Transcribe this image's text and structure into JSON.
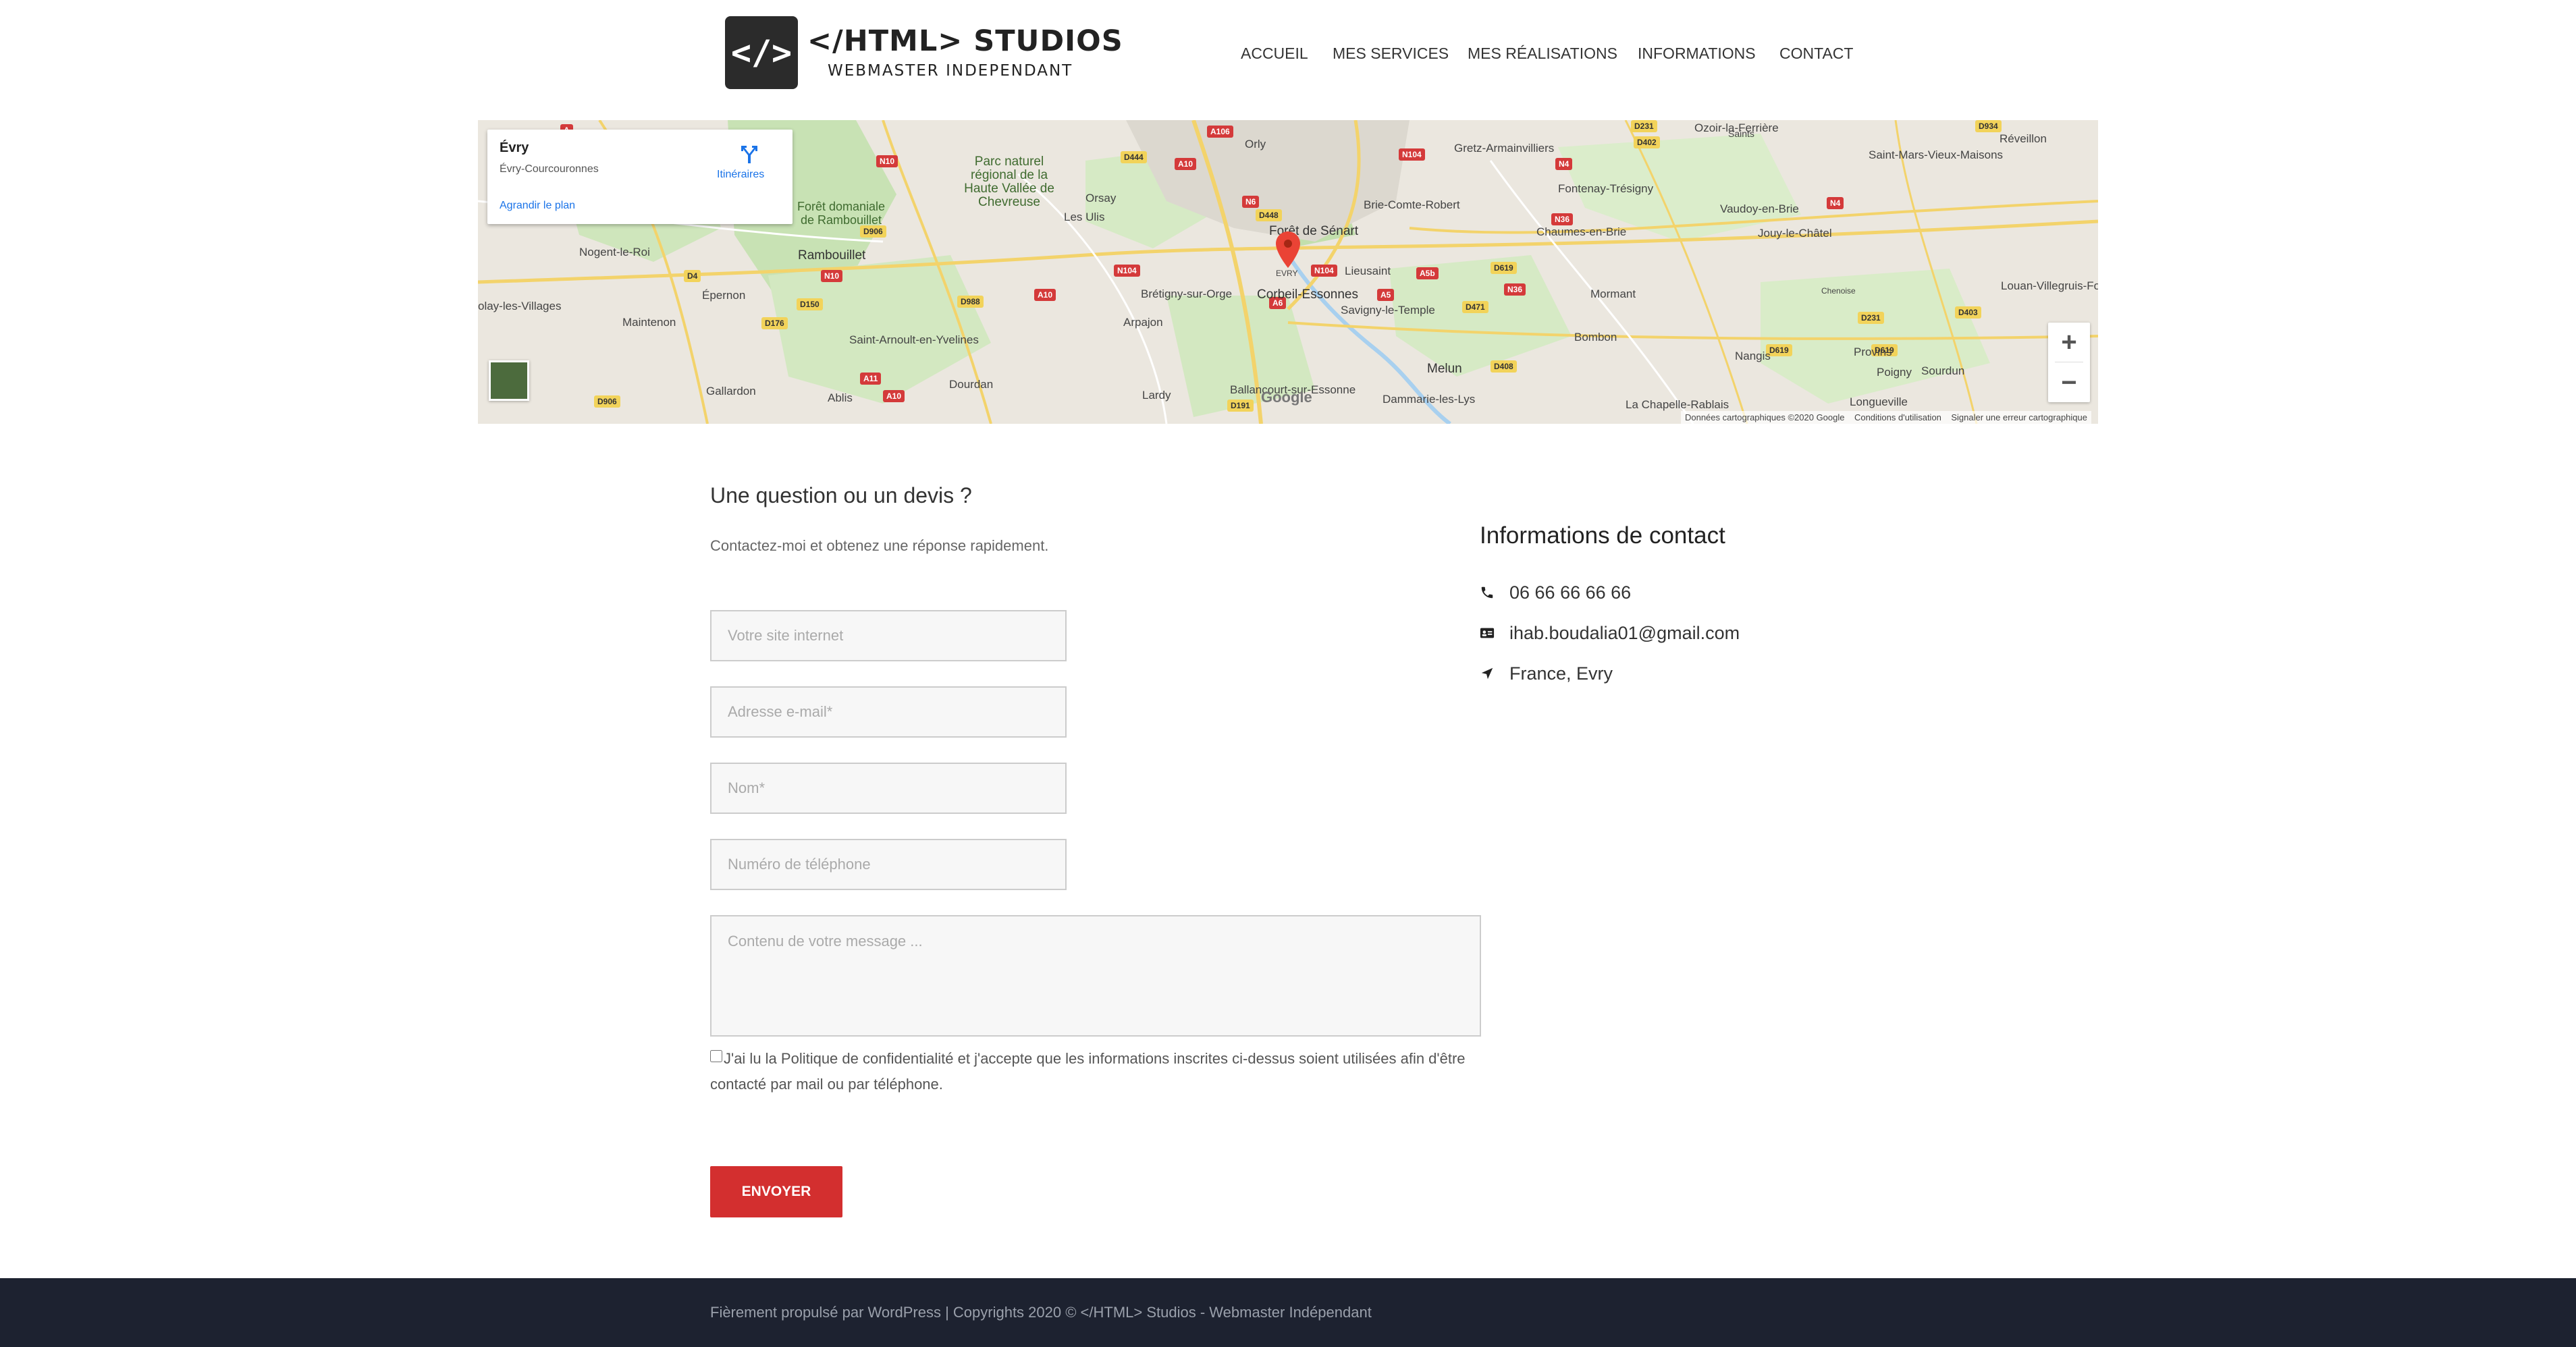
{
  "header": {
    "logo_glyph": "</>",
    "brand_title": "</HTML> STUDIOS",
    "brand_subtitle": "WEBMASTER INDEPENDANT",
    "nav": [
      {
        "label": "ACCUEIL"
      },
      {
        "label": "MES SERVICES"
      },
      {
        "label": "MES RÉALISATIONS"
      },
      {
        "label": "INFORMATIONS"
      },
      {
        "label": "CONTACT"
      }
    ]
  },
  "map": {
    "card_title": "Évry",
    "card_subtitle": "Évry-Courcouronnes",
    "card_link": "Agrandir le plan",
    "directions_label": "Itinéraires",
    "zoom_in": "+",
    "zoom_out": "−",
    "google": "Google",
    "footer_data": "Données cartographiques ©2020 Google",
    "footer_terms": "Conditions d'utilisation",
    "footer_report": "Signaler une erreur cartographique",
    "places": [
      "Orsay",
      "Les Ulis",
      "Arpajon",
      "Dourdan",
      "Rambouillet",
      "Épernon",
      "Maintenon",
      "Nogent-le-Roi",
      "Saint-Arnoult-en-Yvelines",
      "Gallardon",
      "Ablis",
      "Lardy",
      "Brétigny-sur-Orge",
      "Forêt de Sénart",
      "Corbeil-Essonnes",
      "Savigny-le-Temple",
      "Lieusaint",
      "Melun",
      "Dammarie-les-Lys",
      "Brie-Comte-Robert",
      "Gretz-Armainvilliers",
      "Fontenay-Trésigny",
      "Chaumes-en-Brie",
      "Vaudoy-en-Brie",
      "Jouy-le-Châtel",
      "Mormant",
      "Bombon",
      "Nangis",
      "Provins",
      "Sourdun",
      "Poigny",
      "Longueville",
      "La Chapelle-Rablais",
      "Saints",
      "Saint-Mars-Vieux-Maisons",
      "Réveillon",
      "Louan-Villegruis-Fon",
      "Chenoise",
      "Orly",
      "Ozoir-la-Ferrière",
      "Parc naturel régional de la Haute Vallée de Chevreuse",
      "Forêt domaniale de Rambouillet",
      "Ballancourt-sur-Essonne",
      "olay-les-Villages",
      "EVRY"
    ]
  },
  "form": {
    "title": "Une question ou un devis ?",
    "description": "Contactez-moi et obtenez une réponse rapidement.",
    "website_placeholder": "Votre site internet",
    "email_placeholder": "Adresse e-mail*",
    "name_placeholder": "Nom*",
    "phone_placeholder": "Numéro de téléphone",
    "message_placeholder": "Contenu de votre message ...",
    "consent": "J'ai lu la Politique de confidentialité et j'accepte que les informations inscrites ci-dessus soient utilisées afin d'être contacté par mail ou par téléphone.",
    "submit": "ENVOYER"
  },
  "contact": {
    "title": "Informations de contact",
    "phone": "06 66 66 66 66",
    "email": "ihab.boudalia01@gmail.com",
    "location": "France, Evry"
  },
  "footer": {
    "text": "Fièrement propulsé par WordPress | Copyrights 2020 © </HTML> Studios - Webmaster Indépendant"
  },
  "colors": {
    "accent": "#d32f2f",
    "footer_bg": "#1d2230",
    "link_blue": "#1a73e8"
  }
}
